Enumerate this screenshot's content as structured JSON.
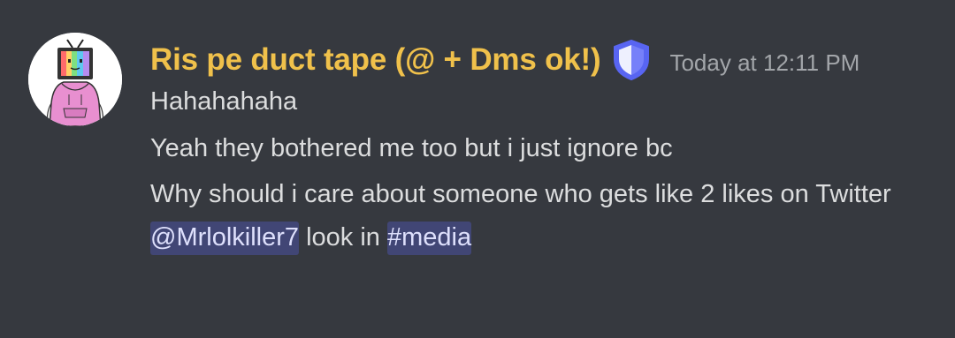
{
  "message": {
    "author": {
      "username": "Ris pe duct tape (@ + Dms ok!)",
      "username_color": "#f0c14b",
      "badge_icon": "shield-icon",
      "avatar_icon": "tv-head-hoodie-avatar"
    },
    "timestamp": "Today at 12:11 PM",
    "lines": [
      "Hahahahaha",
      "Yeah they bothered me too but i just ignore bc",
      "Why should i care about someone who gets like 2 likes on Twitter"
    ],
    "last_line": {
      "user_mention": "@Mrlolkiller7",
      "middle_text": " look in ",
      "channel_mention": "#media"
    }
  },
  "colors": {
    "background": "#36393f",
    "text": "#dcddde",
    "timestamp": "#a3a6aa",
    "mention_bg": "#414675",
    "mention_text": "#dee0fc",
    "badge": "#5865f2"
  }
}
